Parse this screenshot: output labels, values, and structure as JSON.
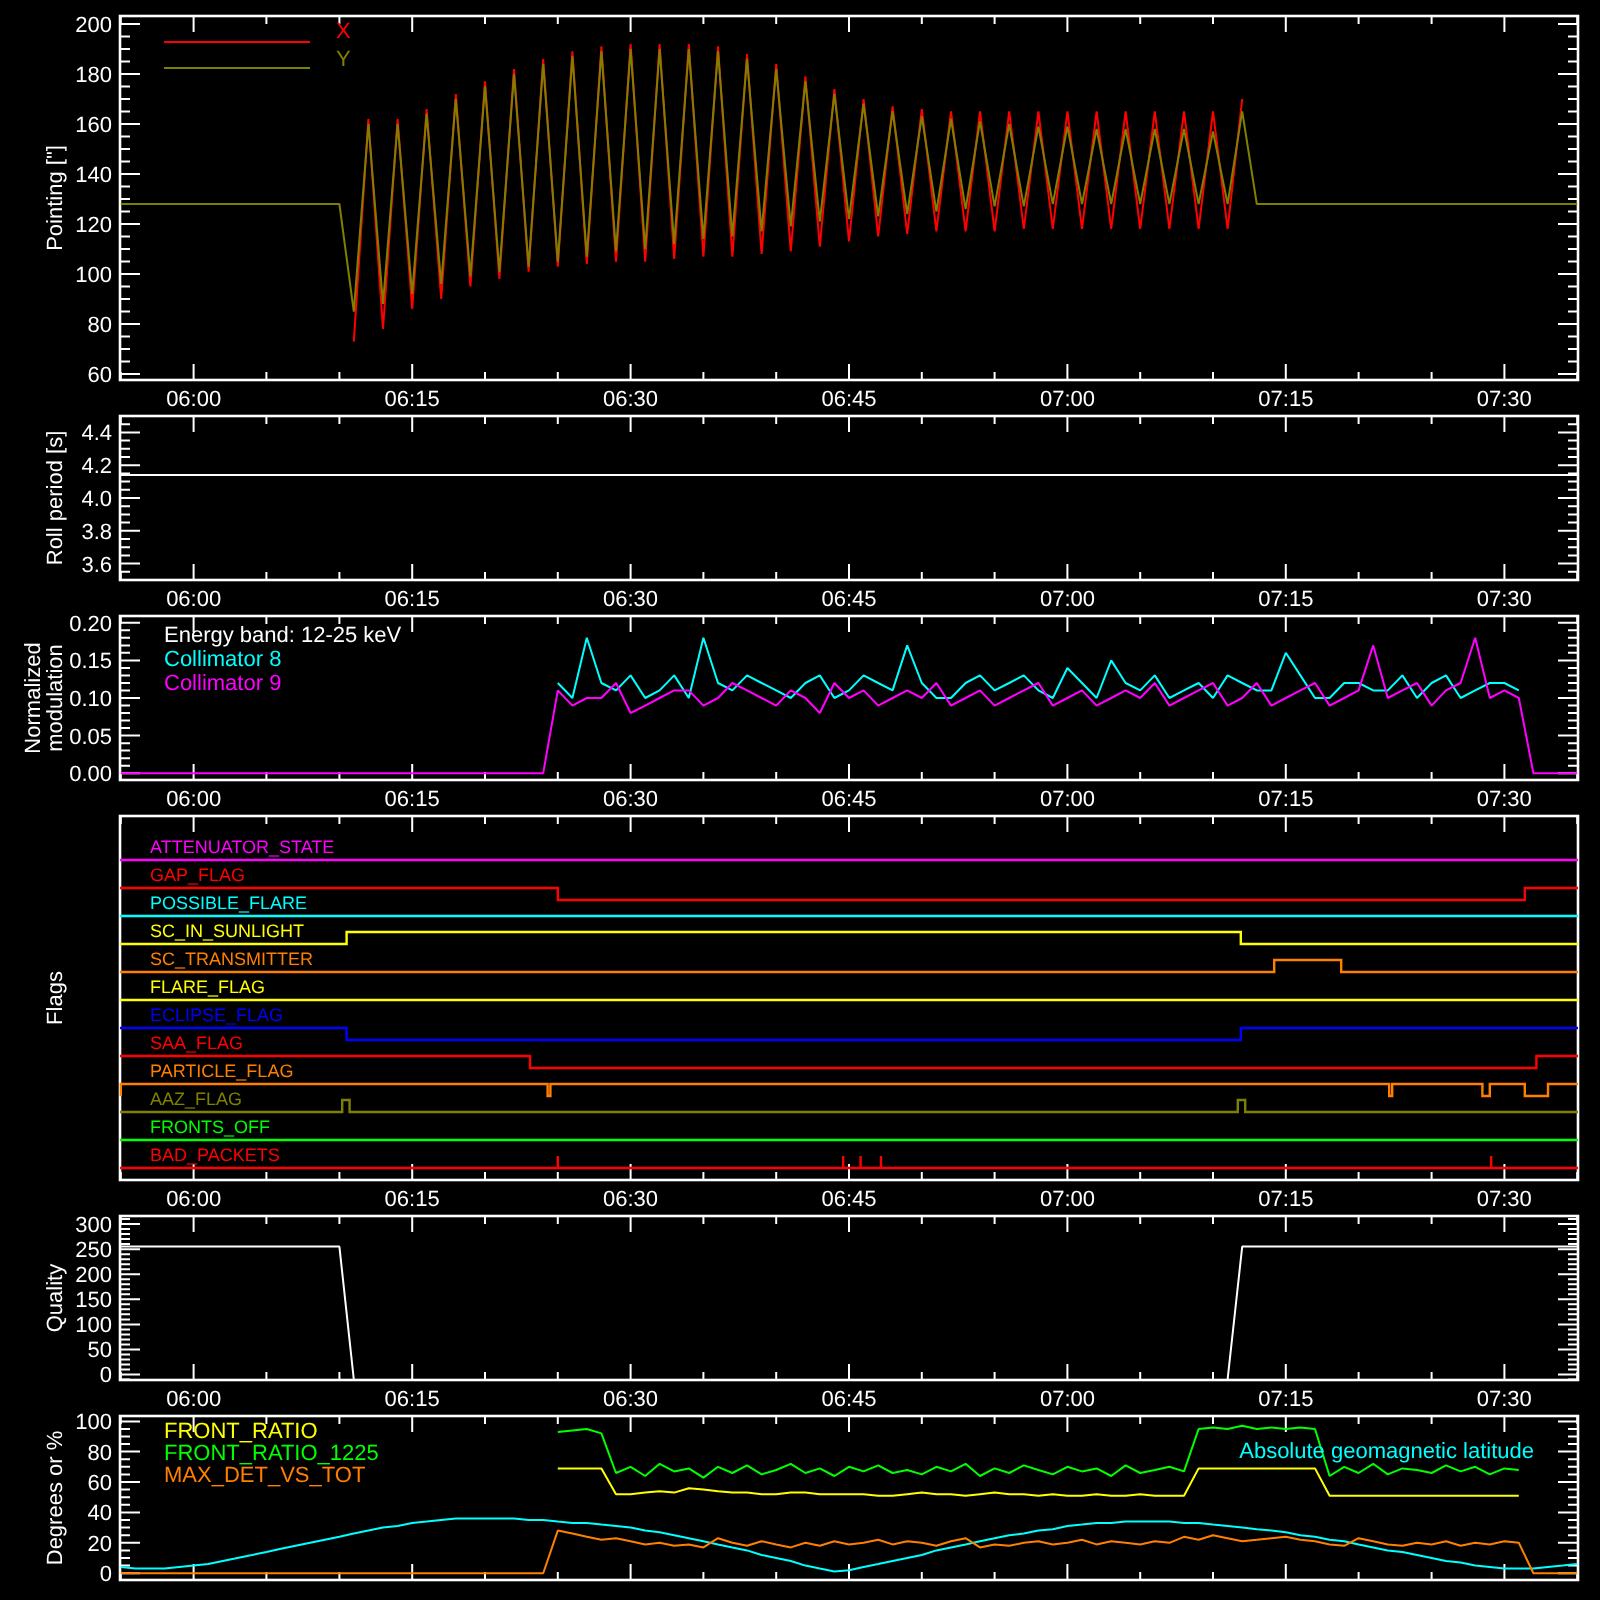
{
  "pointing_panel": {
    "chart_data": {
      "type": "line",
      "ylabel": "Pointing [\"]",
      "categories": [
        null,
        null,
        null,
        null,
        null,
        "06:00",
        null,
        null,
        null,
        null,
        null,
        null,
        null,
        null,
        null,
        null,
        null,
        null,
        null,
        null,
        "06:15",
        null,
        null,
        null,
        null,
        null,
        null,
        null,
        null,
        null,
        null,
        null,
        null,
        null,
        null,
        "06:30",
        null,
        null,
        null,
        null,
        null,
        null,
        null,
        null,
        null,
        null,
        null,
        null,
        null,
        null,
        "06:45",
        null,
        null,
        null,
        null,
        null,
        null,
        null,
        null,
        null,
        null,
        null,
        null,
        null,
        null,
        "07:00",
        null,
        null,
        null,
        null,
        null,
        null,
        null,
        null,
        null,
        null,
        null,
        null,
        null,
        null,
        "07:15",
        null,
        null,
        null,
        null,
        null,
        null,
        null,
        null,
        null,
        null,
        null,
        null,
        null,
        null,
        "07:30",
        null,
        null,
        null,
        null,
        null
      ],
      "series": [
        {
          "name": "X",
          "color": "#ff0000",
          "values": [
            null,
            null,
            null,
            null,
            null,
            null,
            null,
            null,
            null,
            null,
            null,
            null,
            null,
            null,
            null,
            null,
            73,
            162,
            78,
            162,
            86,
            166,
            90,
            172,
            95,
            177,
            98,
            182,
            101,
            186,
            103,
            189,
            104,
            191,
            105,
            192,
            105,
            192,
            106,
            192,
            107,
            191,
            107,
            188,
            108,
            184,
            109,
            179,
            111,
            174,
            113,
            170,
            115,
            167,
            116,
            166,
            117,
            165,
            117,
            165,
            117,
            165,
            118,
            165,
            118,
            165,
            118,
            165,
            118,
            165,
            118,
            165,
            118,
            165,
            118,
            165,
            118,
            170,
            null,
            null,
            null,
            null,
            null,
            null,
            null,
            null,
            null,
            null,
            null,
            null,
            null,
            null,
            null,
            null,
            null,
            null,
            null,
            null,
            null,
            null,
            null
          ]
        },
        {
          "name": "Y",
          "color": "#808000",
          "values": [
            128,
            128,
            128,
            128,
            128,
            128,
            128,
            128,
            128,
            128,
            128,
            128,
            128,
            128,
            128,
            128,
            85,
            160,
            88,
            160,
            92,
            164,
            96,
            170,
            99,
            175,
            101,
            180,
            103,
            184,
            105,
            187,
            107,
            189,
            109,
            190,
            110,
            190,
            112,
            190,
            114,
            189,
            115,
            186,
            117,
            182,
            119,
            177,
            121,
            172,
            122,
            168,
            123,
            165,
            124,
            163,
            125,
            162,
            126,
            161,
            127,
            160,
            127,
            159,
            128,
            159,
            128,
            158,
            128,
            158,
            128,
            158,
            128,
            158,
            128,
            157,
            128,
            165,
            128,
            128,
            128,
            128,
            128,
            128,
            128,
            128,
            128,
            128,
            128,
            128,
            128,
            128,
            128,
            128,
            128,
            128,
            128,
            128,
            128,
            128,
            128
          ]
        }
      ],
      "ylim": [
        57.6,
        203.2
      ],
      "yticks": [
        60,
        80,
        100,
        120,
        140,
        160,
        180,
        200
      ]
    }
  },
  "roll_period_panel": {
    "chart_data": {
      "type": "line",
      "ylabel": "Roll period [s]",
      "categories": [
        null,
        null,
        null,
        null,
        null,
        "06:00",
        null,
        null,
        null,
        null,
        null,
        null,
        null,
        null,
        null,
        null,
        null,
        null,
        null,
        null,
        "06:15",
        null,
        null,
        null,
        null,
        null,
        null,
        null,
        null,
        null,
        null,
        null,
        null,
        null,
        null,
        "06:30",
        null,
        null,
        null,
        null,
        null,
        null,
        null,
        null,
        null,
        null,
        null,
        null,
        null,
        null,
        "06:45",
        null,
        null,
        null,
        null,
        null,
        null,
        null,
        null,
        null,
        null,
        null,
        null,
        null,
        null,
        "07:00",
        null,
        null,
        null,
        null,
        null,
        null,
        null,
        null,
        null,
        null,
        null,
        null,
        null,
        null,
        "07:15",
        null,
        null,
        null,
        null,
        null,
        null,
        null,
        null,
        null,
        null,
        null,
        null,
        null,
        null,
        "07:30",
        null,
        null,
        null,
        null,
        null
      ],
      "series": [
        {
          "color": "#ffffff",
          "values": [
            4.14,
            4.14,
            4.14,
            4.14,
            4.14,
            4.14,
            4.14,
            4.14,
            4.14,
            4.14,
            4.14,
            4.14,
            4.14,
            4.14,
            4.14,
            4.14,
            4.14,
            4.14,
            4.14,
            4.14,
            4.14,
            4.14,
            4.14,
            4.14,
            4.14,
            4.14,
            4.14,
            4.14,
            4.14,
            4.14,
            4.14,
            4.14,
            4.14,
            4.14,
            4.14,
            4.14,
            4.14,
            4.14,
            4.14,
            4.14,
            4.14,
            4.14,
            4.14,
            4.14,
            4.14,
            4.14,
            4.14,
            4.14,
            4.14,
            4.14,
            4.14,
            4.14,
            4.14,
            4.14,
            4.14,
            4.14,
            4.14,
            4.14,
            4.14,
            4.14,
            4.14,
            4.14,
            4.14,
            4.14,
            4.14,
            4.14,
            4.14,
            4.14,
            4.14,
            4.14,
            4.14,
            4.14,
            4.14,
            4.14,
            4.14,
            4.14,
            4.14,
            4.14,
            4.14,
            4.14,
            4.14,
            4.14,
            4.14,
            4.14,
            4.14,
            4.14,
            4.14,
            4.14,
            4.14,
            4.14,
            4.14,
            4.14,
            4.14,
            4.14,
            4.14,
            4.14,
            4.14,
            4.14,
            4.14,
            4.14,
            4.14
          ]
        }
      ],
      "ylim": [
        3.5,
        4.5
      ],
      "yticks": [
        {
          "value": 3.6,
          "label": "3.6"
        },
        {
          "value": 3.8,
          "label": "3.8"
        },
        {
          "value": 4,
          "label": "4.0"
        },
        {
          "value": 4.2,
          "label": "4.2"
        },
        {
          "value": 4.4,
          "label": "4.4"
        }
      ]
    }
  },
  "modulation_panel": {
    "chart_data": {
      "type": "line",
      "ylabel": "Normalized modulation",
      "categories": [
        null,
        null,
        null,
        null,
        null,
        "06:00",
        null,
        null,
        null,
        null,
        null,
        null,
        null,
        null,
        null,
        null,
        null,
        null,
        null,
        null,
        "06:15",
        null,
        null,
        null,
        null,
        null,
        null,
        null,
        null,
        null,
        null,
        null,
        null,
        null,
        null,
        "06:30",
        null,
        null,
        null,
        null,
        null,
        null,
        null,
        null,
        null,
        null,
        null,
        null,
        null,
        null,
        "06:45",
        null,
        null,
        null,
        null,
        null,
        null,
        null,
        null,
        null,
        null,
        null,
        null,
        null,
        null,
        "07:00",
        null,
        null,
        null,
        null,
        null,
        null,
        null,
        null,
        null,
        null,
        null,
        null,
        null,
        null,
        "07:15",
        null,
        null,
        null,
        null,
        null,
        null,
        null,
        null,
        null,
        null,
        null,
        null,
        null,
        null,
        "07:30",
        null,
        null,
        null,
        null,
        null
      ],
      "series": [
        {
          "name": "Collimator 8",
          "color": "#00ffff",
          "values": [
            null,
            null,
            null,
            null,
            null,
            null,
            null,
            null,
            null,
            null,
            null,
            null,
            null,
            null,
            null,
            null,
            null,
            null,
            null,
            null,
            null,
            null,
            null,
            null,
            null,
            null,
            null,
            null,
            null,
            null,
            0.12,
            0.1,
            0.18,
            0.12,
            0.11,
            0.13,
            0.1,
            0.11,
            0.13,
            0.1,
            0.18,
            0.12,
            0.11,
            0.13,
            0.12,
            0.11,
            0.1,
            0.12,
            0.13,
            0.1,
            0.11,
            0.13,
            0.12,
            0.11,
            0.17,
            0.12,
            0.1,
            0.1,
            0.12,
            0.13,
            0.11,
            0.12,
            0.13,
            0.11,
            0.1,
            0.14,
            0.12,
            0.1,
            0.15,
            0.12,
            0.11,
            0.13,
            0.1,
            0.11,
            0.12,
            0.1,
            0.13,
            0.12,
            0.11,
            0.11,
            0.16,
            0.13,
            0.1,
            0.1,
            0.12,
            0.12,
            0.11,
            0.11,
            0.13,
            0.1,
            0.12,
            0.13,
            0.1,
            0.11,
            0.12,
            0.12,
            0.11,
            null,
            null,
            null,
            null
          ]
        },
        {
          "name": "Collimator 9",
          "color": "#ff00ff",
          "values": [
            0,
            0,
            0,
            0,
            0,
            0,
            0,
            0,
            0,
            0,
            0,
            0,
            0,
            0,
            0,
            0,
            0,
            0,
            0,
            0,
            0,
            0,
            0,
            0,
            0,
            0,
            0,
            0,
            0,
            0,
            0.11,
            0.09,
            0.1,
            0.1,
            0.12,
            0.08,
            0.09,
            0.1,
            0.11,
            0.11,
            0.09,
            0.1,
            0.12,
            0.11,
            0.1,
            0.09,
            0.11,
            0.1,
            0.08,
            0.12,
            0.1,
            0.11,
            0.09,
            0.1,
            0.11,
            0.1,
            0.12,
            0.09,
            0.1,
            0.11,
            0.09,
            0.1,
            0.11,
            0.12,
            0.09,
            0.1,
            0.11,
            0.09,
            0.1,
            0.11,
            0.1,
            0.12,
            0.09,
            0.1,
            0.11,
            0.12,
            0.09,
            0.1,
            0.12,
            0.09,
            0.1,
            0.11,
            0.12,
            0.09,
            0.1,
            0.11,
            0.17,
            0.1,
            0.11,
            0.12,
            0.09,
            0.11,
            0.12,
            0.18,
            0.1,
            0.11,
            0.1,
            0,
            0,
            0,
            0
          ]
        }
      ],
      "ylim": [
        -0.009,
        0.209
      ],
      "yticks": [
        {
          "value": 0,
          "label": "0.00"
        },
        {
          "value": 0.05,
          "label": "0.05"
        },
        {
          "value": 0.1,
          "label": "0.10"
        },
        {
          "value": 0.15,
          "label": "0.15"
        },
        {
          "value": 0.2,
          "label": "0.20"
        }
      ],
      "annotations": [
        {
          "text": "Energy band: 12-25 keV"
        }
      ]
    }
  },
  "flags_panel": {
    "ylabel": "Flags",
    "xtick_labels": [
      "06:00",
      "06:15",
      "06:30",
      "06:45",
      "07:00",
      "07:15",
      "07:30"
    ],
    "flags": [
      {
        "label": "ATTENUATOR_STATE",
        "color": "#ff00ff"
      },
      {
        "label": "GAP_FLAG",
        "color": "#ff0000"
      },
      {
        "label": "POSSIBLE_FLARE",
        "color": "#00ffff"
      },
      {
        "label": "SC_IN_SUNLIGHT",
        "color": "#ffff00"
      },
      {
        "label": "SC_TRANSMITTER",
        "color": "#ff8000"
      },
      {
        "label": "FLARE_FLAG",
        "color": "#ffff00"
      },
      {
        "label": "ECLIPSE_FLAG",
        "color": "#0000ff"
      },
      {
        "label": "SAA_FLAG",
        "color": "#ff0000"
      },
      {
        "label": "PARTICLE_FLAG",
        "color": "#ff8000"
      },
      {
        "label": "AAZ_FLAG",
        "color": "#808000"
      },
      {
        "label": "FRONTS_OFF",
        "color": "#00ff00"
      },
      {
        "label": "BAD_PACKETS",
        "color": "#ff0000"
      }
    ]
  },
  "quality_panel": {
    "chart_data": {
      "type": "line",
      "ylabel": "Quality",
      "categories": [
        null,
        null,
        null,
        null,
        null,
        "06:00",
        null,
        null,
        null,
        null,
        null,
        null,
        null,
        null,
        null,
        null,
        null,
        null,
        null,
        null,
        "06:15",
        null,
        null,
        null,
        null,
        null,
        null,
        null,
        null,
        null,
        null,
        null,
        null,
        null,
        null,
        "06:30",
        null,
        null,
        null,
        null,
        null,
        null,
        null,
        null,
        null,
        null,
        null,
        null,
        null,
        null,
        "06:45",
        null,
        null,
        null,
        null,
        null,
        null,
        null,
        null,
        null,
        null,
        null,
        null,
        null,
        null,
        "07:00",
        null,
        null,
        null,
        null,
        null,
        null,
        null,
        null,
        null,
        null,
        null,
        null,
        null,
        null,
        "07:15",
        null,
        null,
        null,
        null,
        null,
        null,
        null,
        null,
        null,
        null,
        null,
        null,
        null,
        null,
        "07:30",
        null,
        null,
        null,
        null,
        null
      ],
      "series": [
        {
          "color": "#ffffff",
          "values": [
            255,
            255,
            255,
            255,
            255,
            255,
            255,
            255,
            255,
            255,
            255,
            255,
            255,
            255,
            255,
            255,
            -10,
            null,
            null,
            null,
            null,
            null,
            null,
            null,
            null,
            null,
            null,
            null,
            null,
            null,
            null,
            null,
            null,
            null,
            null,
            null,
            null,
            null,
            null,
            null,
            null,
            null,
            null,
            null,
            null,
            null,
            null,
            null,
            null,
            null,
            null,
            null,
            null,
            null,
            null,
            null,
            null,
            null,
            null,
            null,
            null,
            null,
            null,
            null,
            null,
            null,
            null,
            null,
            null,
            null,
            null,
            null,
            null,
            null,
            null,
            null,
            -10,
            255,
            255,
            255,
            255,
            255,
            255,
            255,
            255,
            255,
            255,
            255,
            255,
            255,
            255,
            255,
            255,
            255,
            255,
            255,
            255,
            255,
            255,
            255,
            255
          ]
        }
      ],
      "ylim": [
        -11,
        316
      ],
      "yticks": [
        0,
        50,
        100,
        150,
        200,
        250,
        300
      ]
    }
  },
  "degrees_panel": {
    "chart_data": {
      "type": "line",
      "ylabel": "Degrees or %",
      "categories": [
        null,
        null,
        null,
        null,
        null,
        null,
        null,
        null,
        null,
        null,
        null,
        null,
        null,
        null,
        null,
        null,
        null,
        null,
        null,
        null,
        null,
        null,
        null,
        null,
        null,
        null,
        null,
        null,
        null,
        null,
        null,
        null,
        null,
        null,
        null,
        null,
        null,
        null,
        null,
        null,
        null,
        null,
        null,
        null,
        null,
        null,
        null,
        null,
        null,
        null,
        null,
        null,
        null,
        null,
        null,
        null,
        null,
        null,
        null,
        null,
        null,
        null,
        null,
        null,
        null,
        null,
        null,
        null,
        null,
        null,
        null,
        null,
        null,
        null,
        null,
        null,
        null,
        null,
        null,
        null,
        null,
        null,
        null,
        null,
        null,
        null,
        null,
        null,
        null,
        null,
        null,
        null,
        null,
        null,
        null,
        null,
        null,
        null,
        null,
        null,
        null
      ],
      "series": [
        {
          "name": "FRONT_RATIO",
          "color": "#ffff00",
          "values": [
            null,
            null,
            null,
            null,
            null,
            null,
            null,
            null,
            null,
            null,
            null,
            null,
            null,
            null,
            null,
            null,
            null,
            null,
            null,
            null,
            null,
            null,
            null,
            null,
            null,
            null,
            null,
            null,
            null,
            null,
            69,
            69,
            69,
            69,
            52,
            52,
            53,
            54,
            53,
            56,
            55,
            54,
            53,
            53,
            52,
            52,
            53,
            53,
            52,
            52,
            52,
            52,
            51,
            51,
            52,
            53,
            52,
            52,
            51,
            52,
            53,
            52,
            52,
            51,
            52,
            51,
            51,
            52,
            51,
            51,
            52,
            51,
            51,
            51,
            69,
            69,
            69,
            69,
            69,
            69,
            69,
            69,
            69,
            51,
            51,
            51,
            51,
            51,
            51,
            51,
            51,
            51,
            51,
            51,
            51,
            51,
            51,
            null,
            null,
            null,
            null
          ]
        },
        {
          "name": "FRONT_RATIO_1225",
          "color": "#00ff00",
          "values": [
            null,
            null,
            null,
            null,
            null,
            null,
            null,
            null,
            null,
            null,
            null,
            null,
            null,
            null,
            null,
            null,
            null,
            null,
            null,
            null,
            null,
            null,
            null,
            null,
            null,
            null,
            null,
            null,
            null,
            null,
            93,
            94,
            95,
            92,
            66,
            70,
            64,
            72,
            67,
            69,
            63,
            70,
            66,
            71,
            65,
            68,
            72,
            66,
            69,
            64,
            70,
            67,
            71,
            66,
            68,
            65,
            70,
            67,
            72,
            64,
            69,
            66,
            71,
            68,
            65,
            70,
            67,
            69,
            64,
            71,
            66,
            68,
            70,
            67,
            95,
            96,
            95,
            97,
            95,
            96,
            95,
            96,
            95,
            64,
            70,
            66,
            72,
            65,
            69,
            68,
            66,
            71,
            67,
            70,
            65,
            69,
            68,
            null,
            null,
            null,
            null
          ]
        },
        {
          "name": "MAX_DET_VS_TOT",
          "color": "#ff8000",
          "values": [
            0,
            0,
            0,
            0,
            0,
            0,
            0,
            0,
            0,
            0,
            0,
            0,
            0,
            0,
            0,
            0,
            0,
            0,
            0,
            0,
            0,
            0,
            0,
            0,
            0,
            0,
            0,
            0,
            0,
            0,
            28,
            26,
            24,
            22,
            23,
            21,
            19,
            20,
            18,
            19,
            17,
            23,
            20,
            18,
            21,
            19,
            17,
            20,
            18,
            21,
            19,
            20,
            22,
            19,
            21,
            20,
            18,
            21,
            23,
            17,
            19,
            18,
            20,
            21,
            19,
            20,
            22,
            19,
            21,
            20,
            19,
            21,
            20,
            24,
            22,
            25,
            23,
            21,
            22,
            23,
            24,
            22,
            21,
            19,
            18,
            23,
            21,
            19,
            18,
            20,
            19,
            21,
            18,
            20,
            19,
            21,
            20,
            0,
            0,
            0,
            0
          ]
        },
        {
          "name": "Absolute geomagnetic latitude",
          "color": "#00ffff",
          "values": [
            4,
            3,
            3,
            3,
            4,
            5,
            6,
            8,
            10,
            12,
            14,
            16,
            18,
            20,
            22,
            24,
            26,
            28,
            30,
            31,
            33,
            34,
            35,
            36,
            36,
            36,
            36,
            36,
            35,
            35,
            34,
            33,
            33,
            32,
            31,
            30,
            28,
            27,
            25,
            23,
            21,
            19,
            17,
            15,
            12,
            10,
            8,
            5,
            3,
            1,
            2,
            4,
            6,
            8,
            10,
            12,
            15,
            17,
            19,
            21,
            23,
            25,
            26,
            28,
            29,
            31,
            32,
            33,
            33,
            34,
            34,
            34,
            34,
            33,
            33,
            32,
            31,
            30,
            29,
            28,
            27,
            25,
            24,
            22,
            21,
            19,
            17,
            15,
            14,
            12,
            10,
            8,
            7,
            5,
            4,
            3,
            3,
            3,
            4,
            5,
            6
          ]
        }
      ],
      "ylim": [
        -4.5,
        103.5
      ],
      "yticks": [
        0,
        20,
        40,
        60,
        80,
        100
      ]
    }
  }
}
